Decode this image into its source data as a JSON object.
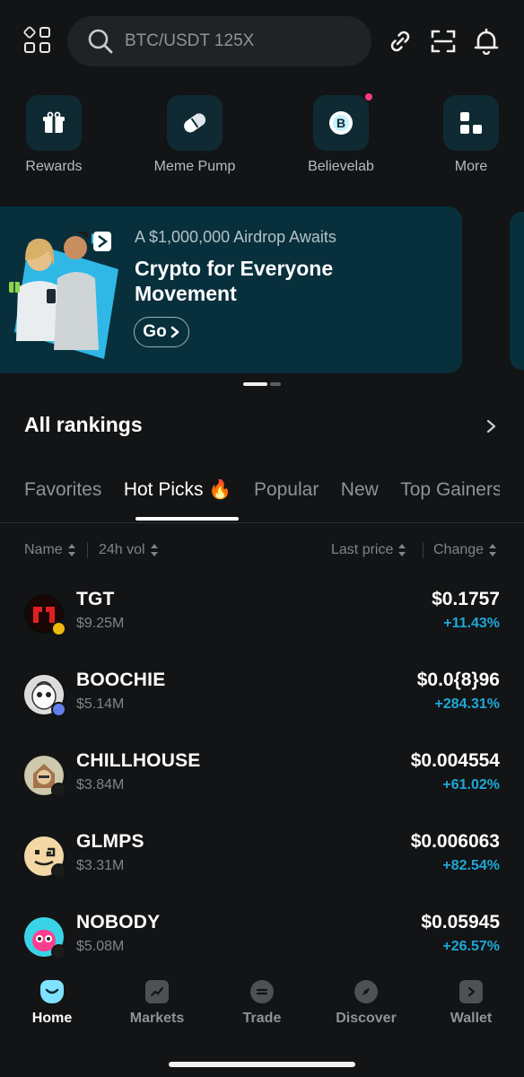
{
  "search": {
    "placeholder": "BTC/USDT 125X"
  },
  "quick_actions": [
    {
      "label": "Rewards",
      "icon": "gift-icon"
    },
    {
      "label": "Meme Pump",
      "icon": "pill-icon"
    },
    {
      "label": "Believelab",
      "icon": "b-logo-icon",
      "has_dot": true
    },
    {
      "label": "More",
      "icon": "apps-icon"
    }
  ],
  "banner": {
    "subtitle": "A $1,000,000 Airdrop Awaits",
    "title": "Crypto for Everyone Movement",
    "button": "Go",
    "pages": 2,
    "active_page": 1
  },
  "rankings": {
    "title": "All rankings"
  },
  "tabs": [
    "Favorites",
    "Hot Picks 🔥",
    "Popular",
    "New",
    "Top Gainers"
  ],
  "active_tab": "Hot Picks 🔥",
  "columns": {
    "name": "Name",
    "vol": "24h vol",
    "price": "Last price",
    "change": "Change"
  },
  "tokens": [
    {
      "symbol": "TGT",
      "volume": "$9.25M",
      "price": "$0.1757",
      "change": "+11.43%",
      "chain": "bnb"
    },
    {
      "symbol": "BOOCHIE",
      "volume": "$5.14M",
      "price": "$0.0{8}96",
      "change": "+284.31%",
      "chain": "eth"
    },
    {
      "symbol": "CHILLHOUSE",
      "volume": "$3.84M",
      "price": "$0.004554",
      "change": "+61.02%",
      "chain": "sol"
    },
    {
      "symbol": "GLMPS",
      "volume": "$3.31M",
      "price": "$0.006063",
      "change": "+82.54%",
      "chain": "sol"
    },
    {
      "symbol": "NOBODY",
      "volume": "$5.08M",
      "price": "$0.05945",
      "change": "+26.57%",
      "chain": "sol"
    }
  ],
  "nav": [
    {
      "label": "Home",
      "icon": "home-icon",
      "active": true
    },
    {
      "label": "Markets",
      "icon": "markets-icon"
    },
    {
      "label": "Trade",
      "icon": "trade-icon"
    },
    {
      "label": "Discover",
      "icon": "discover-icon"
    },
    {
      "label": "Wallet",
      "icon": "wallet-icon"
    }
  ],
  "colors": {
    "accent": "#1ea8d6",
    "background": "#121416",
    "banner": "#08303c"
  }
}
